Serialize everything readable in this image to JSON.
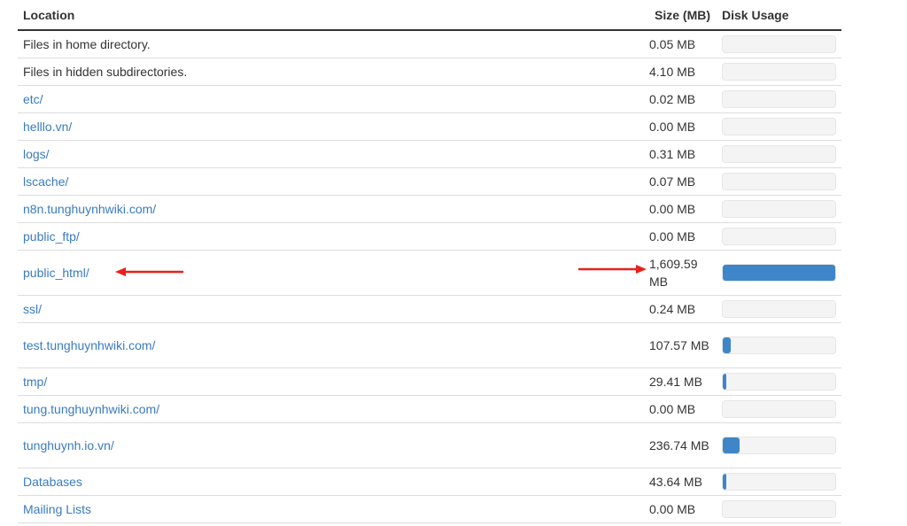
{
  "headers": {
    "location": "Location",
    "size": "Size (MB)",
    "usage": "Disk Usage"
  },
  "rows": [
    {
      "location": "Files in home directory.",
      "size": "0.05 MB",
      "usage": 0.0,
      "link": false
    },
    {
      "location": "Files in hidden subdirectories.",
      "size": "4.10 MB",
      "usage": 0.0025,
      "link": false
    },
    {
      "location": "etc/",
      "size": "0.02 MB",
      "usage": 0.0,
      "link": true
    },
    {
      "location": "helllo.vn/",
      "size": "0.00 MB",
      "usage": 0.0,
      "link": true
    },
    {
      "location": "logs/",
      "size": "0.31 MB",
      "usage": 0.0002,
      "link": true
    },
    {
      "location": "lscache/",
      "size": "0.07 MB",
      "usage": 0.0,
      "link": true
    },
    {
      "location": "n8n.tunghuynhwiki.com/",
      "size": "0.00 MB",
      "usage": 0.0,
      "link": true
    },
    {
      "location": "public_ftp/",
      "size": "0.00 MB",
      "usage": 0.0,
      "link": true
    },
    {
      "location": "public_html/",
      "size": "1,609.59 MB",
      "usage": 1.0,
      "link": true
    },
    {
      "location": "ssl/",
      "size": "0.24 MB",
      "usage": 0.0001,
      "link": true
    },
    {
      "location": "test.tunghuynhwiki.com/",
      "size": "107.57 MB",
      "usage": 0.067,
      "link": true
    },
    {
      "location": "tmp/",
      "size": "29.41 MB",
      "usage": 0.018,
      "link": true
    },
    {
      "location": "tung.tunghuynhwiki.com/",
      "size": "0.00 MB",
      "usage": 0.0,
      "link": true
    },
    {
      "location": "tunghuynh.io.vn/",
      "size": "236.74 MB",
      "usage": 0.147,
      "link": true
    },
    {
      "location": "Databases",
      "size": "43.64 MB",
      "usage": 0.027,
      "link": true
    },
    {
      "location": "Mailing Lists",
      "size": "0.00 MB",
      "usage": 0.0,
      "link": true
    }
  ],
  "colors": {
    "link": "#3a7bbf",
    "bar_fill": "#3f86c8",
    "bar_track": "#f4f4f4",
    "annotation_arrow": "#e8211b"
  }
}
